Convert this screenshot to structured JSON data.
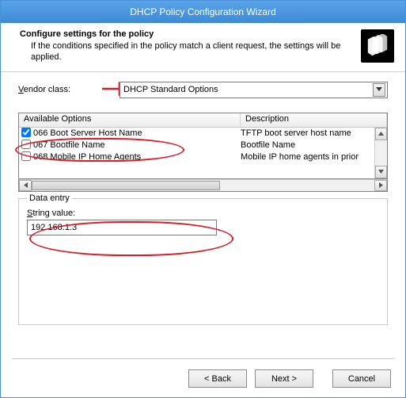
{
  "title": "DHCP Policy Configuration Wizard",
  "header": {
    "heading": "Configure settings for the policy",
    "sub": "If the conditions specified in the policy match a client request, the settings will be applied."
  },
  "vendor": {
    "label": "Vendor class:",
    "value": "DHCP Standard Options"
  },
  "table": {
    "col_options": "Available Options",
    "col_desc": "Description",
    "rows": [
      {
        "checked": true,
        "name": "066 Boot Server Host Name",
        "desc": "TFTP boot server host name"
      },
      {
        "checked": false,
        "name": "067 Bootfile Name",
        "desc": "Bootfile Name"
      },
      {
        "checked": false,
        "name": "068 Mobile IP Home Agents",
        "desc": "Mobile IP home agents in prior"
      }
    ]
  },
  "data_entry": {
    "legend": "Data entry",
    "string_label": "String value:",
    "string_value": "192.168.1.3"
  },
  "buttons": {
    "back": "Back",
    "next": "Next",
    "cancel": "Cancel"
  }
}
